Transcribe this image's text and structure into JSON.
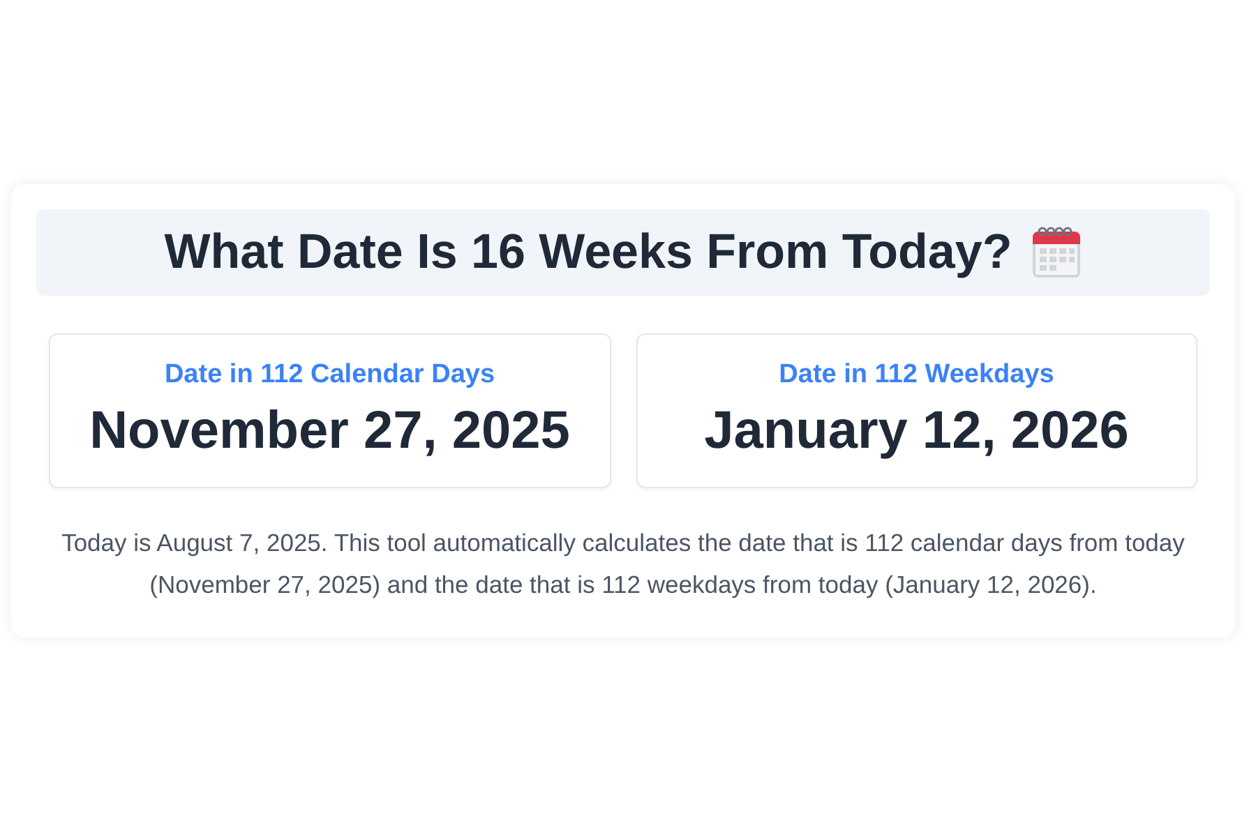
{
  "title": "What Date Is 16 Weeks From Today?",
  "results": [
    {
      "label": "Date in 112 Calendar Days",
      "value": "November 27, 2025"
    },
    {
      "label": "Date in 112 Weekdays",
      "value": "January 12, 2026"
    }
  ],
  "description": "Today is August 7, 2025. This tool automatically calculates the date that is 112 calendar days from today (November 27, 2025) and the date that is 112 weekdays from today (January 12, 2026)."
}
